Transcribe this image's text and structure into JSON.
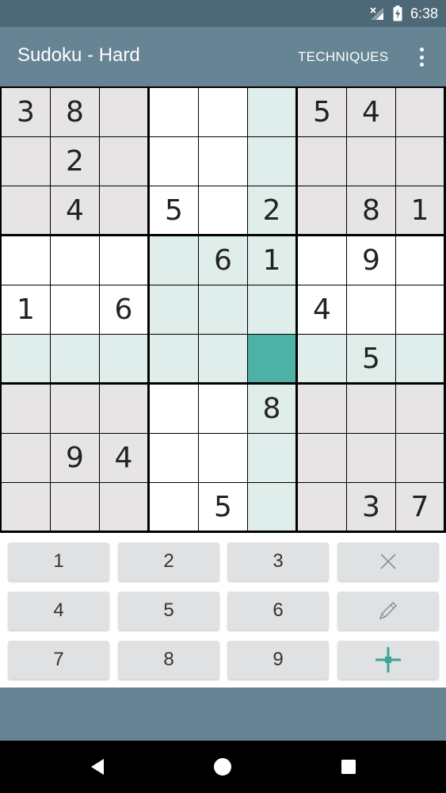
{
  "status_bar": {
    "time": "6:38",
    "signal_icon": "no-signal-icon",
    "battery_icon": "battery-charging-icon"
  },
  "app_bar": {
    "title": "Sudoku - Hard",
    "action_label": "TECHNIQUES",
    "menu_icon": "more-vert-icon"
  },
  "board": {
    "difficulty": "Hard",
    "selected": [
      5,
      5
    ],
    "rows": [
      [
        "3",
        "8",
        "",
        "",
        "",
        "",
        "5",
        "4",
        ""
      ],
      [
        "",
        "2",
        "",
        "",
        "",
        "",
        "",
        "",
        ""
      ],
      [
        "",
        "4",
        "",
        "5",
        "",
        "2",
        "",
        "8",
        "1"
      ],
      [
        "",
        "",
        "",
        "",
        "6",
        "1",
        "",
        "9",
        ""
      ],
      [
        "1",
        "",
        "6",
        "",
        "",
        "",
        "4",
        "",
        ""
      ],
      [
        "",
        "",
        "",
        "",
        "",
        "",
        "",
        "5",
        ""
      ],
      [
        "",
        "",
        "",
        "",
        "",
        "8",
        "",
        "",
        ""
      ],
      [
        "",
        "9",
        "4",
        "",
        "",
        "",
        "",
        "",
        ""
      ],
      [
        "",
        "",
        "",
        "",
        "5",
        "",
        "",
        "3",
        "7"
      ]
    ]
  },
  "keypad": {
    "rows": [
      [
        "1",
        "2",
        "3",
        "erase"
      ],
      [
        "4",
        "5",
        "6",
        "pencil"
      ],
      [
        "7",
        "8",
        "9",
        "hint"
      ]
    ],
    "icons": {
      "erase": "close-icon",
      "pencil": "pencil-icon",
      "hint": "crosshair-icon"
    }
  },
  "colors": {
    "app_bar": "#668494",
    "status_bar": "#4d6877",
    "box_gray": "#e6e4e5",
    "highlight": "#dfeeeb",
    "selected": "#4eb1a5",
    "accent": "#3ea596"
  },
  "nav": {
    "back_icon": "back-icon",
    "home_icon": "home-icon",
    "recents_icon": "recents-icon"
  }
}
